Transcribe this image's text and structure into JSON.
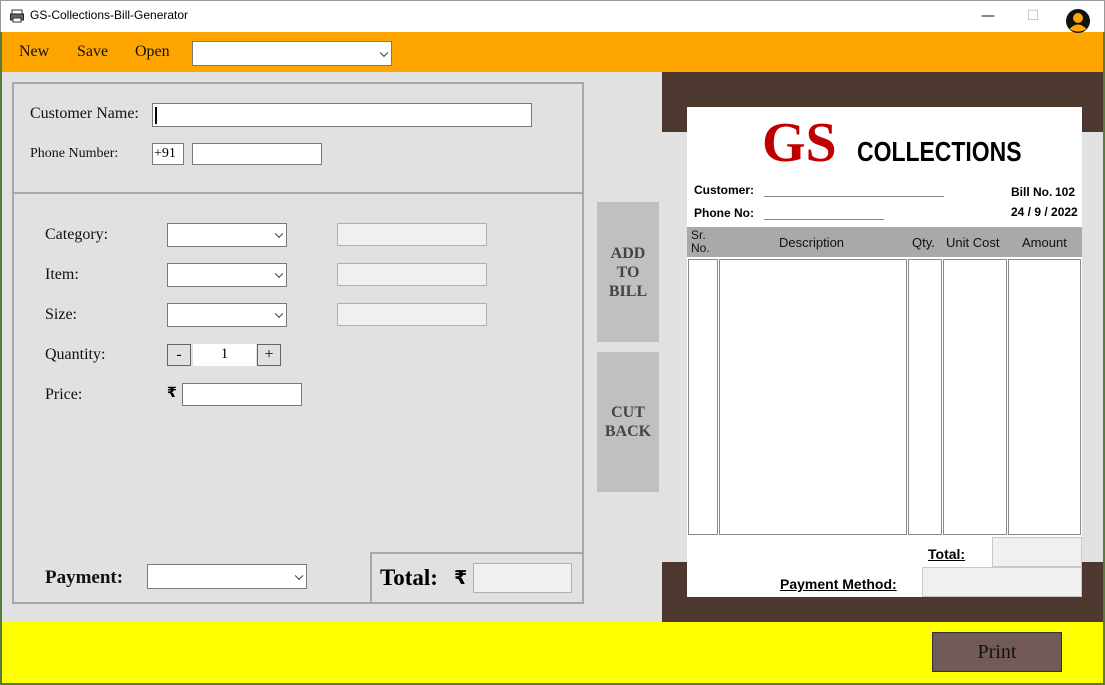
{
  "window": {
    "title": "GS-Collections-Bill-Generator",
    "minimize": "—",
    "maximize": "☐",
    "close": "✕"
  },
  "menu": {
    "new": "New",
    "save": "Save",
    "open": "Open",
    "file_select_value": ""
  },
  "customer": {
    "name_label": "Customer Name:",
    "name_value": "",
    "phone_label": "Phone Number:",
    "phone_prefix": "+91",
    "phone_value": ""
  },
  "item_form": {
    "category_label": "Category:",
    "category_value": "",
    "item_label": "Item:",
    "item_value": "",
    "size_label": "Size:",
    "size_value": "",
    "quantity_label": "Quantity:",
    "quantity_value": "1",
    "minus": "-",
    "plus": "+",
    "price_label": "Price:",
    "rupee": "₹",
    "price_value": ""
  },
  "actions": {
    "add_to_bill": "ADD\nTO\nBILL",
    "cut_back": "CUT\nBACK"
  },
  "payment": {
    "label": "Payment:",
    "value": ""
  },
  "total": {
    "label": "Total:",
    "rupee": "₹",
    "value": ""
  },
  "bill": {
    "brand_gs": "GS",
    "brand_collections": "COLLECTIONS",
    "customer_label": "Customer:",
    "phone_label": "Phone No:",
    "bill_no_label": "Bill No.",
    "bill_no": "102",
    "date": "24 / 9 / 2022",
    "columns": [
      "Sr.\nNo.",
      "Description",
      "Qty.",
      "Unit Cost",
      "Amount"
    ],
    "total_label": "Total:",
    "payment_method_label": "Payment Method:"
  },
  "print_label": "Print",
  "colors": {
    "menubar": "#ffa500",
    "bottombar": "#ffff00",
    "brown_frame": "#4d3830",
    "brand_red": "#c00000",
    "print_button": "#715a57"
  }
}
